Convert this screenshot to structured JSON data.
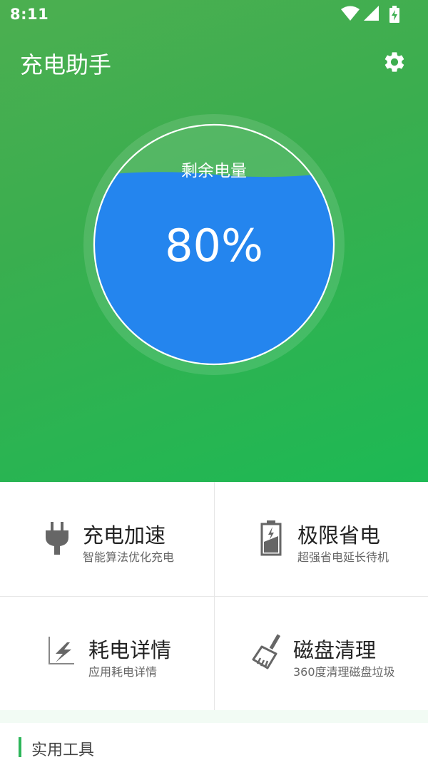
{
  "status_bar": {
    "time": "8:11",
    "icons": [
      "wifi-icon",
      "cell-signal-icon",
      "battery-charging-icon"
    ],
    "color": "#ffffff"
  },
  "app_bar": {
    "title": "充电助手",
    "settings_icon": "gear-icon"
  },
  "battery": {
    "label": "剩余电量",
    "percent_text": "80%",
    "level": 0.8,
    "fill_color": "#2485ee"
  },
  "features": [
    {
      "title": "充电加速",
      "subtitle": "智能算法优化充电",
      "icon": "plug-icon"
    },
    {
      "title": "极限省电",
      "subtitle": "超强省电延长待机",
      "icon": "battery-saver-icon"
    },
    {
      "title": "耗电详情",
      "subtitle": "应用耗电详情",
      "icon": "power-chart-icon"
    },
    {
      "title": "磁盘清理",
      "subtitle": "360度清理磁盘垃圾",
      "icon": "broom-icon"
    }
  ],
  "tools_section": {
    "title": "实用工具",
    "accent_color": "#2db65a"
  },
  "colors": {
    "primary_green": "#3aae4f",
    "icon_gray": "#666666"
  }
}
